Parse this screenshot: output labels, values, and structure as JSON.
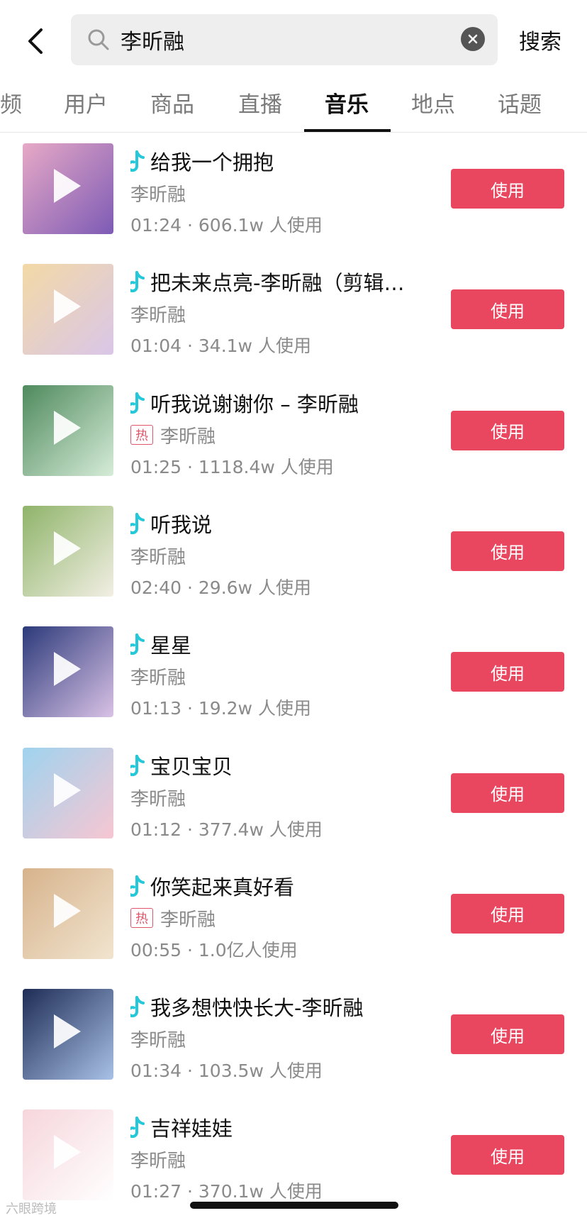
{
  "search": {
    "query": "李昕融",
    "submit_label": "搜索"
  },
  "tabs": [
    {
      "label": "频"
    },
    {
      "label": "用户"
    },
    {
      "label": "商品"
    },
    {
      "label": "直播"
    },
    {
      "label": "音乐"
    },
    {
      "label": "地点"
    },
    {
      "label": "话题"
    }
  ],
  "active_tab": "音乐",
  "colors": {
    "accent": "#e8475f",
    "note_cyan": "#25c8d8"
  },
  "songs": [
    {
      "title": "给我一个拥抱",
      "artist": "李昕融",
      "hot": false,
      "meta": "01:24 · 606.1w 人使用",
      "button": "使用"
    },
    {
      "title": "把未来点亮-李昕融（剪辑…",
      "artist": "李昕融",
      "hot": false,
      "meta": "01:04 · 34.1w 人使用",
      "button": "使用"
    },
    {
      "title": "听我说谢谢你 – 李昕融",
      "artist": "李昕融",
      "hot": true,
      "hot_label": "热",
      "meta": "01:25 · 1118.4w 人使用",
      "button": "使用"
    },
    {
      "title": "听我说",
      "artist": "李昕融",
      "hot": false,
      "meta": "02:40 · 29.6w 人使用",
      "button": "使用"
    },
    {
      "title": "星星",
      "artist": "李昕融",
      "hot": false,
      "meta": "01:13 · 19.2w 人使用",
      "button": "使用"
    },
    {
      "title": "宝贝宝贝",
      "artist": "李昕融",
      "hot": false,
      "meta": "01:12 · 377.4w 人使用",
      "button": "使用"
    },
    {
      "title": "你笑起来真好看",
      "artist": "李昕融",
      "hot": true,
      "hot_label": "热",
      "meta": "00:55 · 1.0亿人使用",
      "button": "使用"
    },
    {
      "title": "我多想快快长大-李昕融",
      "artist": "李昕融",
      "hot": false,
      "meta": "01:34 · 103.5w 人使用",
      "button": "使用"
    },
    {
      "title": "吉祥娃娃",
      "artist": "李昕融",
      "hot": false,
      "meta": "01:27 · 370.1w 人使用",
      "button": "使用"
    }
  ],
  "watermark": "六眼跨境"
}
